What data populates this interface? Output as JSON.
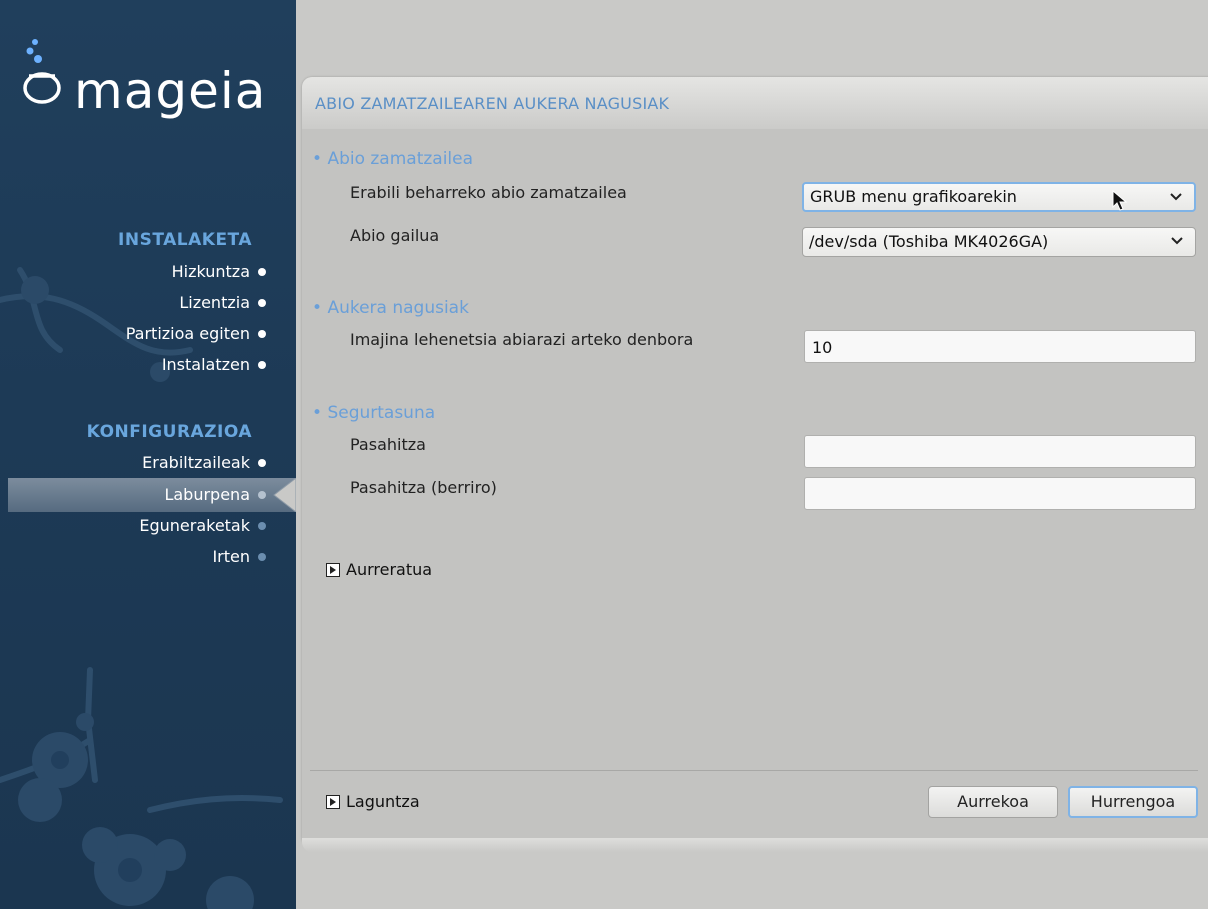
{
  "sidebar": {
    "logo_text": "mageia",
    "sections": [
      {
        "title": "INSTALAKETA",
        "items": [
          {
            "label": "Hizkuntza",
            "state": "done"
          },
          {
            "label": "Lizentzia",
            "state": "done"
          },
          {
            "label": "Partizioa egiten",
            "state": "done"
          },
          {
            "label": "Instalatzen",
            "state": "done"
          }
        ]
      },
      {
        "title": "KONFIGURAZIOA",
        "items": [
          {
            "label": "Erabiltzaileak",
            "state": "done"
          },
          {
            "label": "Laburpena",
            "state": "current"
          },
          {
            "label": "Eguneraketak",
            "state": "future"
          },
          {
            "label": "Irten",
            "state": "future"
          }
        ]
      }
    ]
  },
  "page": {
    "title": "ABIO ZAMATZAILEAREN AUKERA NAGUSIAK",
    "groups": {
      "bootloader": {
        "heading": "Abio zamatzailea",
        "bootloader_label": "Erabili beharreko abio zamatzailea",
        "bootloader_value": "GRUB menu grafikoarekin",
        "device_label": "Abio gailua",
        "device_value": "/dev/sda (Toshiba MK4026GA)"
      },
      "main_options": {
        "heading": "Aukera nagusiak",
        "delay_label": "Imajina lehenetsia abiarazi arteko denbora",
        "delay_value": "10"
      },
      "security": {
        "heading": "Segurtasuna",
        "password_label": "Pasahitza",
        "password_value": "",
        "password_again_label": "Pasahitza (berriro)",
        "password_again_value": ""
      }
    },
    "advanced_label": "Aurreratua",
    "help_label": "Laguntza",
    "previous_label": "Aurrekoa",
    "next_label": "Hurrengoa"
  },
  "colors": {
    "sidebar_bg": "#1d3a56",
    "section_head": "#69a6dd",
    "title_blue": "#5a8fc6",
    "focus_ring": "#7fb3e6"
  }
}
